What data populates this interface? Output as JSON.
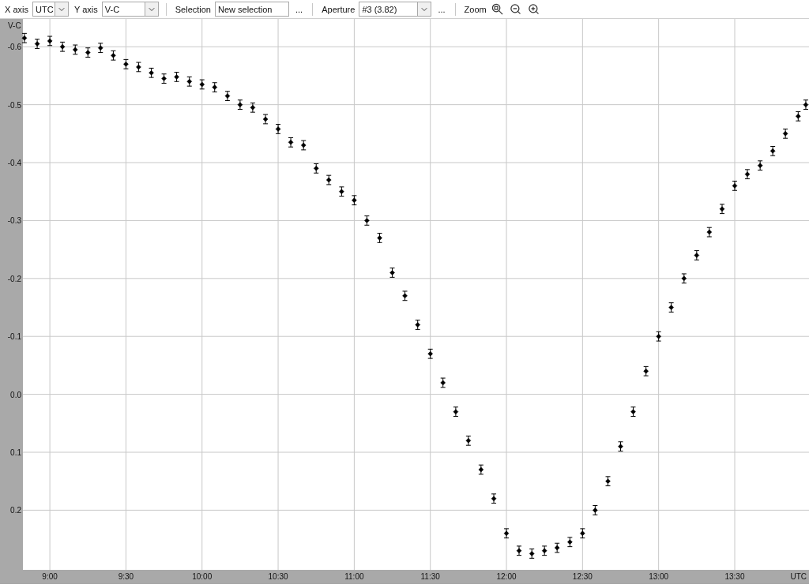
{
  "toolbar": {
    "x_axis": {
      "label": "X axis",
      "value": "UTC"
    },
    "y_axis": {
      "label": "Y axis",
      "value": "V-C"
    },
    "selection": {
      "label": "Selection",
      "value": "New selection",
      "more": "..."
    },
    "aperture": {
      "label": "Aperture",
      "value": "#3 (3.82)",
      "more": "..."
    },
    "zoom": {
      "label": "Zoom"
    }
  },
  "chart": {
    "chart_data": {
      "type": "scatter",
      "grid": true,
      "xlabel": "UTC",
      "ylabel": "V-C",
      "xlim": [
        8.823,
        13.988
      ],
      "ylim": [
        0.303,
        -0.648
      ],
      "xticks": [
        {
          "value": 9,
          "label": "9:00"
        },
        {
          "value": 9.5,
          "label": "9:30"
        },
        {
          "value": 10,
          "label": "10:00"
        },
        {
          "value": 10.5,
          "label": "10:30"
        },
        {
          "value": 11,
          "label": "11:00"
        },
        {
          "value": 11.5,
          "label": "11:30"
        },
        {
          "value": 12,
          "label": "12:00"
        },
        {
          "value": 12.5,
          "label": "12:30"
        },
        {
          "value": 13,
          "label": "13:00"
        },
        {
          "value": 13.5,
          "label": "13:30"
        }
      ],
      "yticks": [
        {
          "value": -0.6,
          "label": "-0.6"
        },
        {
          "value": -0.5,
          "label": "-0.5"
        },
        {
          "value": -0.4,
          "label": "-0.4"
        },
        {
          "value": -0.3,
          "label": "-0.3"
        },
        {
          "value": -0.2,
          "label": "-0.2"
        },
        {
          "value": -0.1,
          "label": "-0.1"
        },
        {
          "value": 0,
          "label": "0.0"
        },
        {
          "value": 0.1,
          "label": "0.1"
        },
        {
          "value": 0.2,
          "label": "0.2"
        }
      ],
      "x": [
        8.833,
        8.917,
        9.0,
        9.083,
        9.167,
        9.25,
        9.333,
        9.417,
        9.5,
        9.583,
        9.667,
        9.75,
        9.833,
        9.917,
        10.0,
        10.083,
        10.167,
        10.25,
        10.333,
        10.417,
        10.5,
        10.583,
        10.667,
        10.75,
        10.833,
        10.917,
        11.0,
        11.083,
        11.167,
        11.25,
        11.333,
        11.417,
        11.5,
        11.583,
        11.667,
        11.75,
        11.833,
        11.917,
        12.0,
        12.083,
        12.167,
        12.25,
        12.333,
        12.417,
        12.5,
        12.583,
        12.667,
        12.75,
        12.833,
        12.917,
        13.0,
        13.083,
        13.167,
        13.25,
        13.333,
        13.417,
        13.5,
        13.583,
        13.667,
        13.75,
        13.833,
        13.917,
        13.967
      ],
      "series": [
        {
          "color": "#000000",
          "errors": [
            0.008,
            0.008,
            0.008,
            0.008,
            0.008,
            0.008,
            0.008,
            0.008,
            0.008,
            0.008,
            0.008,
            0.008,
            0.008,
            0.008,
            0.008,
            0.008,
            0.008,
            0.008,
            0.008,
            0.008,
            0.008,
            0.008,
            0.008,
            0.008,
            0.008,
            0.008,
            0.008,
            0.008,
            0.008,
            0.008,
            0.008,
            0.008,
            0.008,
            0.008,
            0.008,
            0.008,
            0.008,
            0.008,
            0.008,
            0.008,
            0.008,
            0.008,
            0.008,
            0.008,
            0.008,
            0.008,
            0.008,
            0.008,
            0.008,
            0.008,
            0.008,
            0.008,
            0.008,
            0.008,
            0.008,
            0.008,
            0.008,
            0.008,
            0.008,
            0.008,
            0.008,
            0.008,
            0.008
          ],
          "values": [
            -0.615,
            -0.605,
            -0.61,
            -0.6,
            -0.595,
            -0.59,
            -0.598,
            -0.585,
            -0.57,
            -0.565,
            -0.555,
            -0.545,
            -0.548,
            -0.54,
            -0.535,
            -0.53,
            -0.515,
            -0.5,
            -0.495,
            -0.475,
            -0.458,
            -0.435,
            -0.43,
            -0.39,
            -0.37,
            -0.35,
            -0.335,
            -0.3,
            -0.27,
            -0.21,
            -0.17,
            -0.12,
            -0.07,
            -0.02,
            0.03,
            0.08,
            0.13,
            0.18,
            0.24,
            0.27,
            0.275,
            0.27,
            0.265,
            0.255,
            0.24,
            0.2,
            0.15,
            0.09,
            0.03,
            -0.04,
            -0.1,
            -0.15,
            -0.2,
            -0.24,
            -0.28,
            -0.32,
            -0.36,
            -0.38,
            -0.395,
            -0.42,
            -0.45,
            -0.48,
            -0.5
          ]
        }
      ]
    }
  }
}
